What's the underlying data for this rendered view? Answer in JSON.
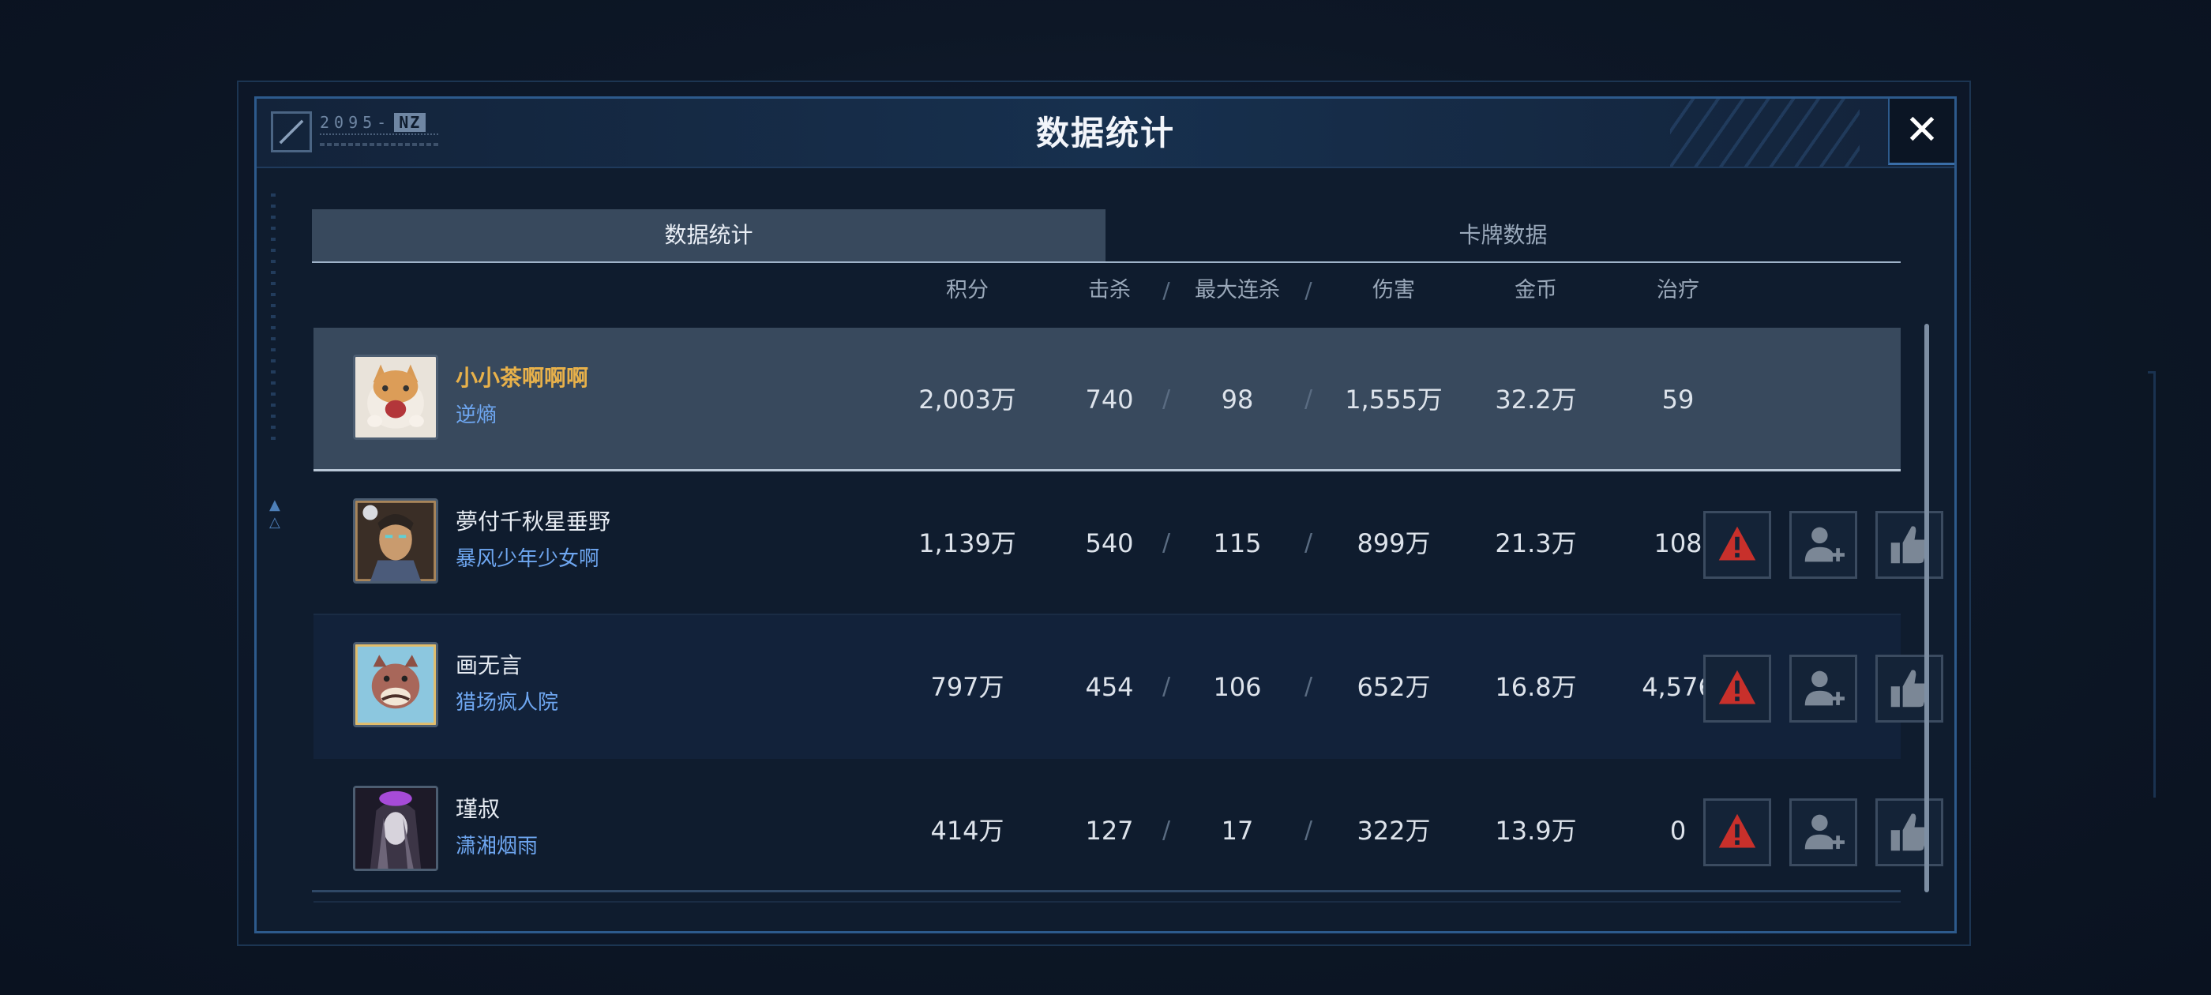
{
  "dialog": {
    "title": "数据统计",
    "serial": "2095-",
    "serial_tag": "NZ",
    "close_label": "✕"
  },
  "tabs": [
    {
      "label": "数据统计",
      "active": true
    },
    {
      "label": "卡牌数据",
      "active": false
    }
  ],
  "columns": {
    "score": "积分",
    "kills": "击杀",
    "max_streak": "最大连杀",
    "damage": "伤害",
    "gold": "金币",
    "heal": "治疗"
  },
  "separator": "/",
  "players": [
    {
      "name": "小小茶啊啊啊",
      "tag": "逆熵",
      "score": "2,003万",
      "kills": "740",
      "max_streak": "98",
      "damage": "1,555万",
      "gold": "32.2万",
      "heal": "59",
      "self": true,
      "avatar": "cat-avatar"
    },
    {
      "name": "夢付千秋星垂野",
      "tag": "暴风少年少女啊",
      "score": "1,139万",
      "kills": "540",
      "max_streak": "115",
      "damage": "899万",
      "gold": "21.3万",
      "heal": "108",
      "self": false,
      "avatar": "warrior-avatar"
    },
    {
      "name": "画无言",
      "tag": "猎场疯人院",
      "score": "797万",
      "kills": "454",
      "max_streak": "106",
      "damage": "652万",
      "gold": "16.8万",
      "heal": "4,576",
      "self": false,
      "avatar": "boar-avatar"
    },
    {
      "name": "瑾叔",
      "tag": "潇湘烟雨",
      "score": "414万",
      "kills": "127",
      "max_streak": "17",
      "damage": "322万",
      "gold": "13.9万",
      "heal": "0",
      "self": false,
      "avatar": "dark-hair-avatar"
    }
  ],
  "actions": [
    {
      "name": "report-button",
      "icon": "warning-icon",
      "color": "#c8302b"
    },
    {
      "name": "add-friend-button",
      "icon": "add-user-icon",
      "color": "#7b8796"
    },
    {
      "name": "like-button",
      "icon": "thumbs-up-icon",
      "color": "#7b8796"
    }
  ],
  "colors": {
    "accent_border": "#2d5a8c",
    "highlight_row": "#38495d",
    "self_name": "#e8b14a",
    "tag_text": "#6ea6f0",
    "warning": "#c8302b"
  }
}
